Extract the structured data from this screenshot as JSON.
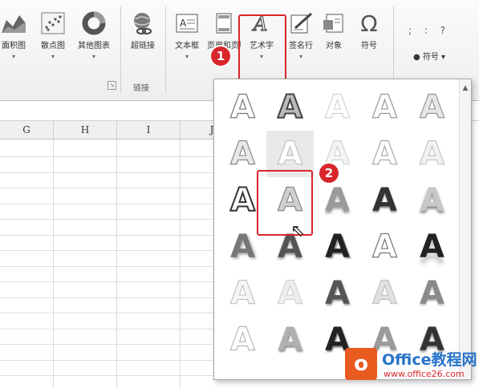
{
  "ribbon": {
    "charts": [
      {
        "id": "area",
        "label": "面积图",
        "icon": "area-chart-icon"
      },
      {
        "id": "scatter",
        "label": "散点图",
        "icon": "scatter-chart-icon"
      },
      {
        "id": "other",
        "label": "其他图表",
        "icon": "donut-chart-icon"
      }
    ],
    "links": {
      "hyperlink_label": "超链接",
      "group_label": "链接",
      "icon": "globe-link-icon"
    },
    "text": [
      {
        "id": "textbox",
        "label": "文本框",
        "icon": "textbox-icon"
      },
      {
        "id": "header",
        "label": "页眉和页脚",
        "icon": "header-footer-icon"
      },
      {
        "id": "wordart",
        "label": "艺术字",
        "icon": "wordart-icon"
      },
      {
        "id": "signature",
        "label": "签名行",
        "icon": "signature-line-icon"
      },
      {
        "id": "object",
        "label": "对象",
        "icon": "object-icon"
      }
    ],
    "symbols": {
      "symbol_label": "符号",
      "symbol_glyph": "Ω",
      "special_label": "符号",
      "special_glyph": "; : ?"
    }
  },
  "callouts": {
    "step1": "1",
    "step2": "2",
    "color": "#d8262b"
  },
  "sheet": {
    "columns": [
      "G",
      "H",
      "I",
      "J"
    ]
  },
  "gallery": {
    "glyph": "A",
    "selected_index": 6
  },
  "watermark": {
    "logo": "o",
    "title": "Office教程网",
    "url": "www.office26.com"
  }
}
